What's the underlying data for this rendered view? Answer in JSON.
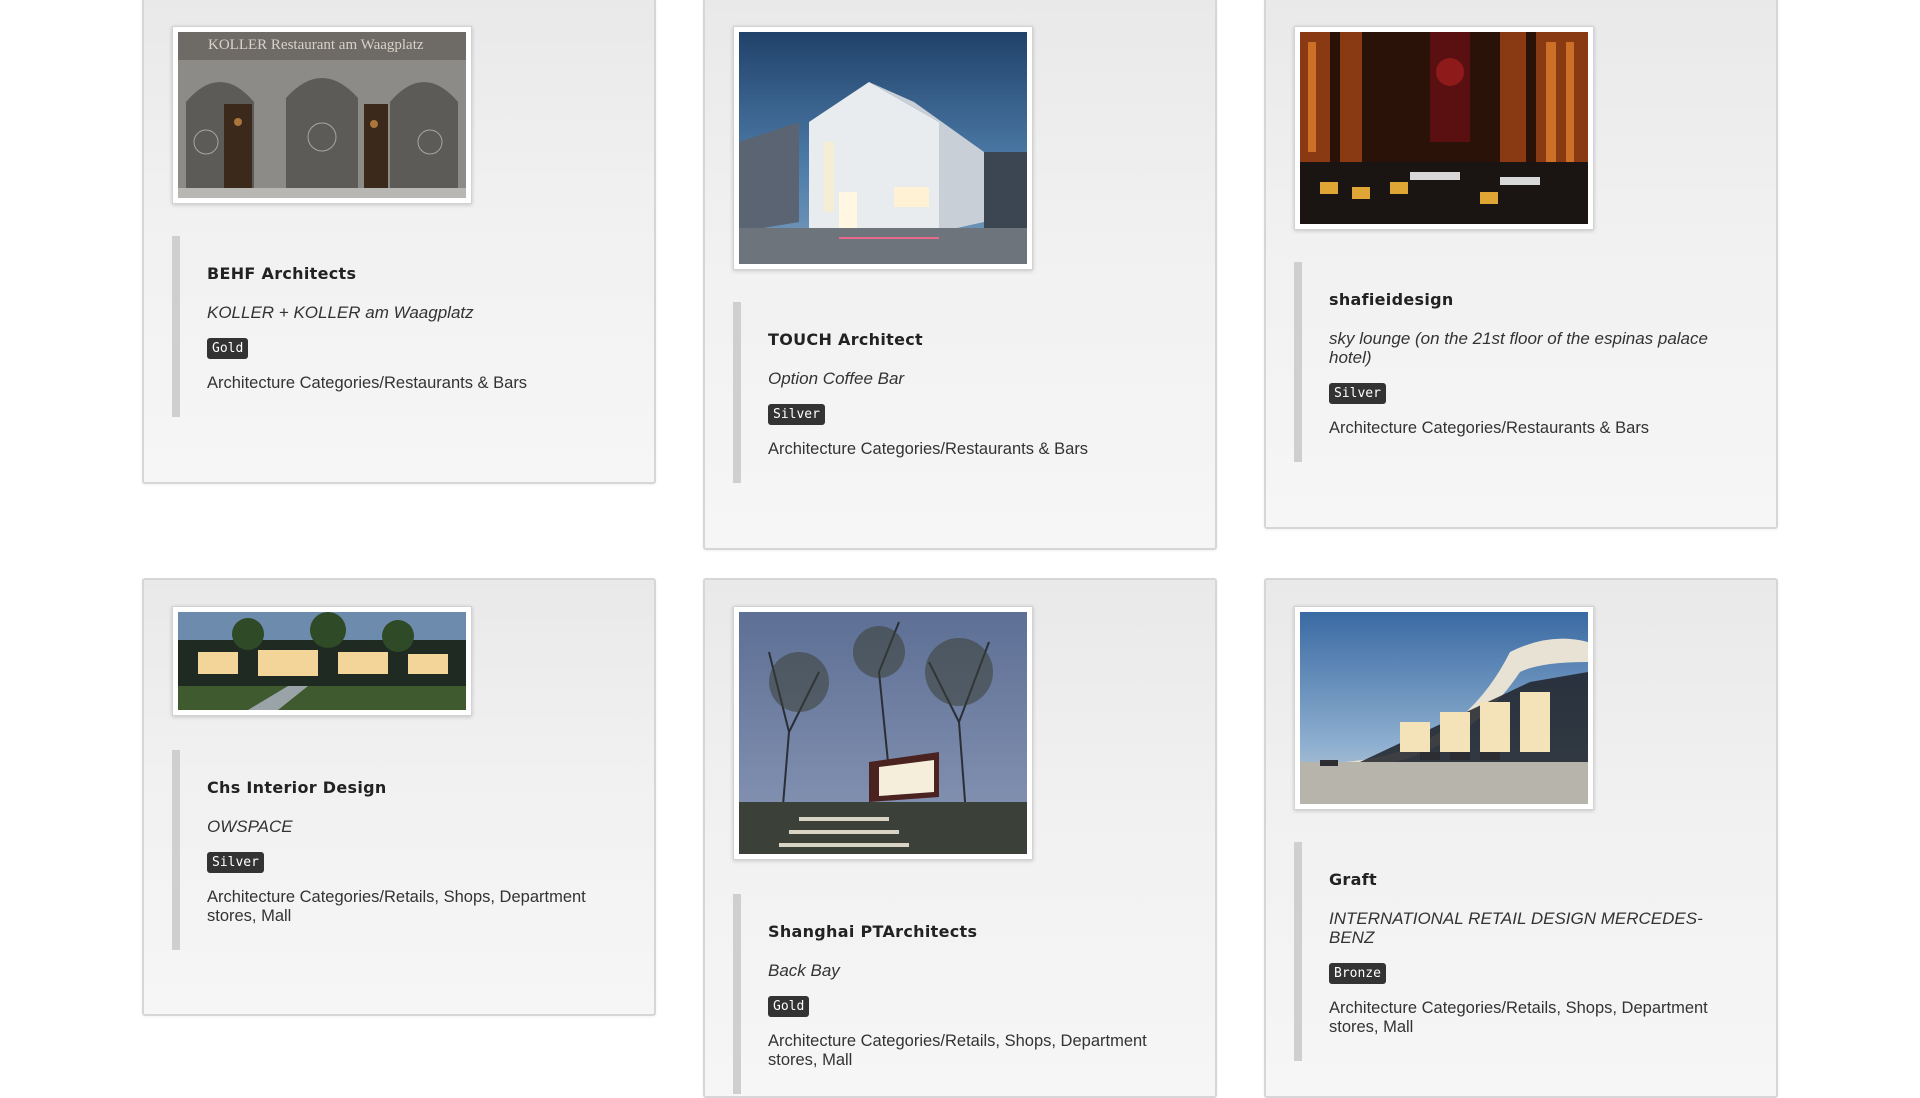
{
  "cards": [
    {
      "firm": "BEHF Architects",
      "project": "KOLLER + KOLLER am Waagplatz",
      "award": "Gold",
      "category": "Architecture Categories/Restaurants & Bars",
      "image_text": "KOLLER Restaurant am Waagplatz"
    },
    {
      "firm": "TOUCH Architect",
      "project": "Option Coffee Bar",
      "award": "Silver",
      "category": "Architecture Categories/Restaurants & Bars"
    },
    {
      "firm": "shafieidesign",
      "project": "sky lounge (on the 21st floor of the espinas palace hotel)",
      "award": "Silver",
      "category": "Architecture Categories/Restaurants & Bars"
    },
    {
      "firm": "Chs Interior Design",
      "project": "OWSPACE",
      "award": "Silver",
      "category": "Architecture Categories/Retails, Shops, Department stores, Mall"
    },
    {
      "firm": "Shanghai PTArchitects",
      "project": "Back Bay",
      "award": "Gold",
      "category": "Architecture Categories/Retails, Shops, Department stores, Mall"
    },
    {
      "firm": "Graft",
      "project": "INTERNATIONAL RETAIL DESIGN MERCEDES-BENZ",
      "award": "Bronze",
      "category": "Architecture Categories/Retails, Shops, Department stores, Mall"
    }
  ],
  "colors": {
    "badge_bg": "#333333",
    "card_border": "#d6d6d6",
    "accent_bar": "#cfcfcf"
  }
}
